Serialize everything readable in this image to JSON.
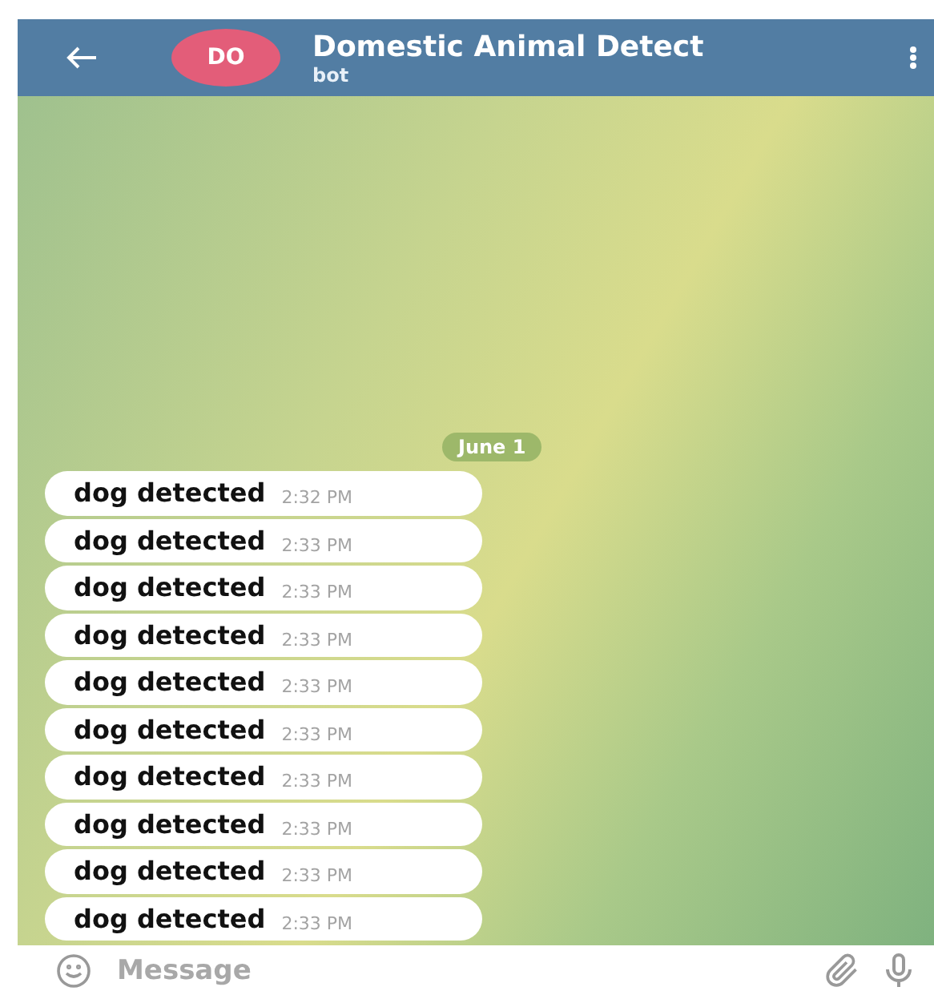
{
  "header": {
    "avatar": "DO",
    "title": "Domestic Animal Detect",
    "subtitle": "bot"
  },
  "date": "June 1",
  "messages": [
    {
      "text": "dog detected",
      "time": "2:32 PM"
    },
    {
      "text": "dog detected",
      "time": "2:33 PM"
    },
    {
      "text": "dog detected",
      "time": "2:33 PM"
    },
    {
      "text": "dog detected",
      "time": "2:33 PM"
    },
    {
      "text": "dog detected",
      "time": "2:33 PM"
    },
    {
      "text": "dog detected",
      "time": "2:33 PM"
    },
    {
      "text": "dog detected",
      "time": "2:33 PM"
    },
    {
      "text": "dog detected",
      "time": "2:33 PM"
    },
    {
      "text": "dog detected",
      "time": "2:33 PM"
    },
    {
      "text": "dog detected",
      "time": "2:33 PM"
    }
  ],
  "composer": {
    "placeholder": "Message"
  }
}
